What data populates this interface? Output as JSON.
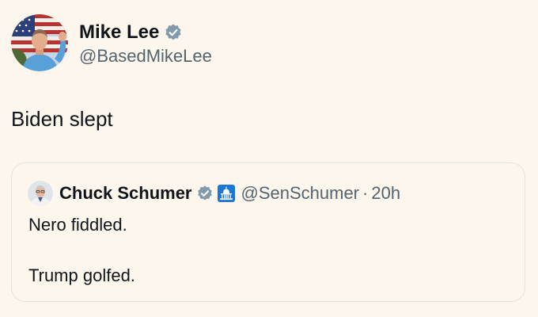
{
  "tweet": {
    "author": {
      "name": "Mike Lee",
      "handle": "@BasedMikeLee",
      "avatar_icon": "avatar-photo-flag",
      "verified_icon": "verified-badge-icon"
    },
    "text": "Biden slept",
    "quote": {
      "author": {
        "name": "Chuck Schumer",
        "handle": "@SenSchumer",
        "avatar_icon": "avatar-photo",
        "verified_icon": "verified-badge-icon",
        "affiliation_icon": "capitol-building-icon"
      },
      "separator": "·",
      "time": "20h",
      "lines": [
        "Nero fiddled.",
        "Trump golfed."
      ]
    }
  },
  "colors": {
    "background": "#fcf6ec",
    "text_primary": "#0f1419",
    "text_secondary": "#536471",
    "verified_gray": "#829aab",
    "gov_blue": "#1d75d6",
    "card_border": "#e9e2d6"
  }
}
